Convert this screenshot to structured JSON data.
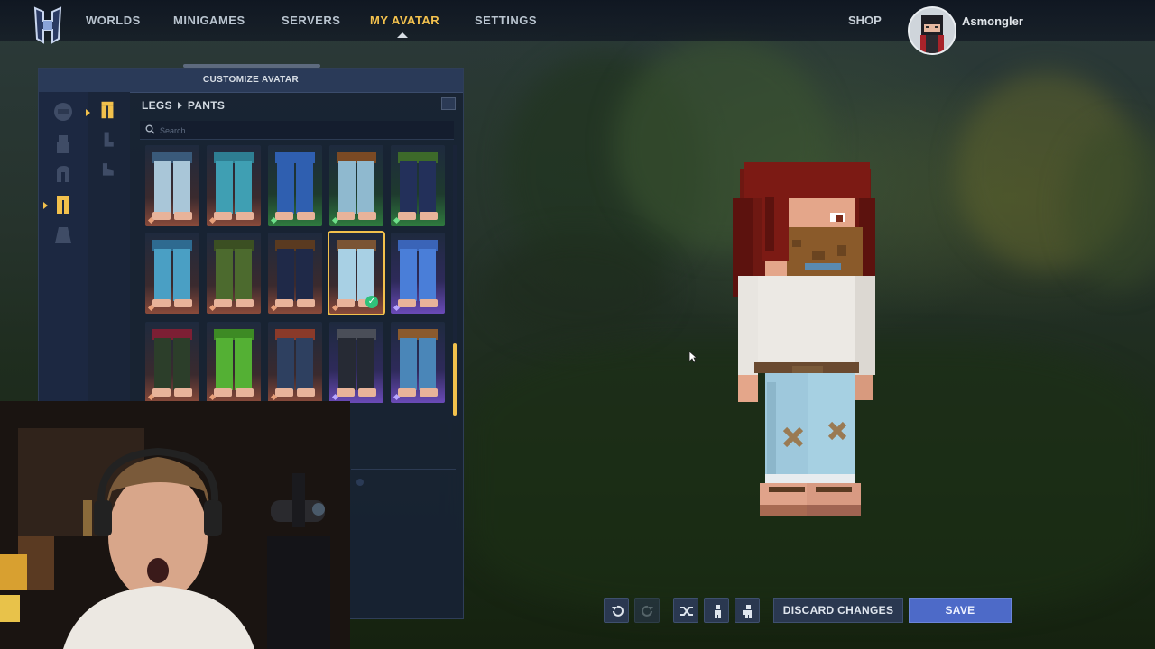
{
  "nav": {
    "items": [
      "WORLDS",
      "MINIGAMES",
      "SERVERS",
      "MY AVATAR",
      "SETTINGS"
    ],
    "active": "MY AVATAR",
    "shop": "SHOP",
    "username": "Asmongler"
  },
  "panel": {
    "title": "CUSTOMIZE AVATAR",
    "breadcrumb": [
      "LEGS",
      "PANTS"
    ],
    "search_placeholder": "Search",
    "category_icons": [
      "head-icon",
      "torso-icon",
      "arm-icon",
      "legs-icon",
      "cape-icon"
    ],
    "subcategory_icons": [
      "pants-icon",
      "socks-icon",
      "shoes-icon"
    ],
    "selected_category": "legs-icon",
    "selected_subcategory": "pants-icon"
  },
  "grid": {
    "items": [
      {
        "name": "light-jeans-ripped",
        "pants": "#a9c6d8",
        "belt": "#3a5a7a",
        "rarity": "common"
      },
      {
        "name": "teal-jeans",
        "pants": "#3f9fb3",
        "belt": "#2e7e92",
        "rarity": "common"
      },
      {
        "name": "blue-ruffle-shorts",
        "pants": "#2f5fb0",
        "belt": "#2f5fb0",
        "rarity": "uncommon"
      },
      {
        "name": "belted-light-jeans",
        "pants": "#8fb9cf",
        "belt": "#7a4a24",
        "rarity": "uncommon"
      },
      {
        "name": "navy-moss-trousers",
        "pants": "#23305a",
        "belt": "#3d6a2a",
        "rarity": "uncommon"
      },
      {
        "name": "blue-plaid-pants",
        "pants": "#4a9fc4",
        "belt": "#2e6a90",
        "rarity": "common"
      },
      {
        "name": "olive-cargo-shorts",
        "pants": "#4c6a2e",
        "belt": "#3b4f22",
        "rarity": "common"
      },
      {
        "name": "dark-navy-pants",
        "pants": "#1f2948",
        "belt": "#5a3a20",
        "rarity": "common"
      },
      {
        "name": "patched-light-jeans",
        "pants": "#a8d0e4",
        "belt": "#7a5434",
        "rarity": "common",
        "selected": true
      },
      {
        "name": "lace-blue-skirt",
        "pants": "#4a7ed8",
        "belt": "#3a64b8",
        "rarity": "epic"
      },
      {
        "name": "maroon-kilt",
        "pants": "#2c3e2a",
        "belt": "#7c1f34",
        "rarity": "common"
      },
      {
        "name": "grass-skirt",
        "pants": "#54b034",
        "belt": "#3d8a24",
        "rarity": "common"
      },
      {
        "name": "red-fringed-pants",
        "pants": "#2e4060",
        "belt": "#8a3a2a",
        "rarity": "common"
      },
      {
        "name": "black-armored-pants",
        "pants": "#262a34",
        "belt": "#4a4e58",
        "rarity": "epic"
      },
      {
        "name": "belted-blue-jeans",
        "pants": "#4a86b8",
        "belt": "#8a5a2e",
        "rarity": "epic"
      }
    ]
  },
  "rarity_colors": {
    "common": "#a85a4a",
    "uncommon": "#3e8a48",
    "epic": "#6a4ab8"
  },
  "toolbar": {
    "icons": [
      "undo-icon",
      "redo-icon",
      "shuffle-icon",
      "pose-icon",
      "pose-alt-icon"
    ],
    "discard": "DISCARD CHANGES",
    "save": "SAVE"
  },
  "colors": {
    "accent": "#f2c14c",
    "panel": "#18223a",
    "save": "#4d6ac8"
  }
}
